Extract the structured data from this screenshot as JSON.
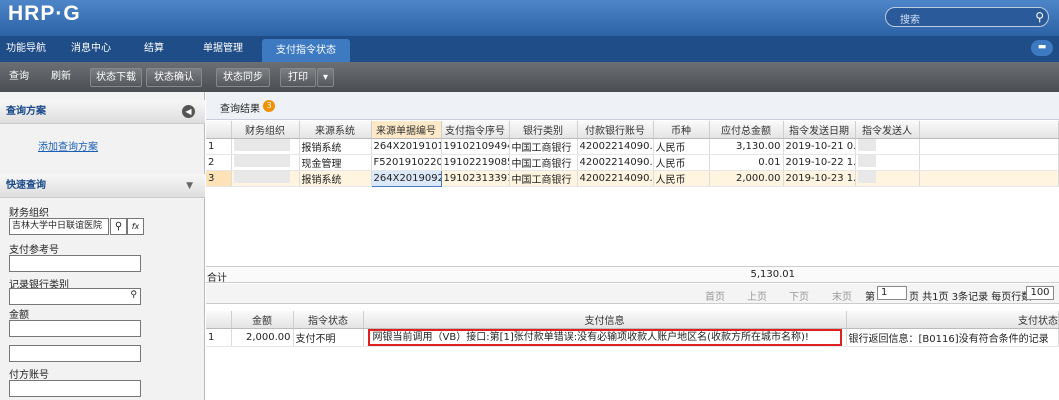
{
  "app": {
    "logo": "HRP·G",
    "search_placeholder": "搜索"
  },
  "nav": {
    "tabs": [
      "功能导航",
      "消息中心",
      "结算",
      "单据管理",
      "支付指令状态"
    ],
    "active": "支付指令状态"
  },
  "toolbar": {
    "buttons": [
      "查询",
      "刷新",
      "状态下载",
      "状态确认",
      "状态同步",
      "打印"
    ]
  },
  "sidebar": {
    "query_plan_title": "查询方案",
    "add_plan_link": "添加查询方案",
    "quick_query_title": "快速查询",
    "fields": [
      {
        "label": "财务组织",
        "value": "吉林大学中日联谊医院"
      },
      {
        "label": "支付参考号",
        "value": ""
      },
      {
        "label": "记录银行类别",
        "value": ""
      },
      {
        "label": "金额",
        "value": ""
      },
      {
        "label": "",
        "value": ""
      },
      {
        "label": "付方账号",
        "value": ""
      }
    ]
  },
  "results": {
    "title": "查询结果",
    "count": "3",
    "columns": [
      "财务组织",
      "来源系统",
      "来源单据编号",
      "支付指令序号",
      "银行类别",
      "付款银行账号",
      "币种",
      "应付总金额",
      "指令发送日期",
      "指令发送人"
    ],
    "rows": [
      {
        "n": "1",
        "org": "",
        "source": "报销系统",
        "doc": "264X2019101...",
        "seq": "19102109494...",
        "bank": "中国工商银行",
        "account": "42002214090...",
        "currency": "人民币",
        "amount": "3,130.00",
        "date": "2019-10-21 0...",
        "sender": ""
      },
      {
        "n": "2",
        "org": "",
        "source": "现金管理",
        "doc": "F5201910220...",
        "seq": "19102219085...",
        "bank": "中国工商银行",
        "account": "42002214090...",
        "currency": "人民币",
        "amount": "0.01",
        "date": "2019-10-22 1...",
        "sender": ""
      },
      {
        "n": "3",
        "org": "",
        "source": "报销系统",
        "doc": "264X2019092...",
        "seq": "19102313391...",
        "bank": "中国工商银行",
        "account": "42002214090...",
        "currency": "人民币",
        "amount": "2,000.00",
        "date": "2019-10-23 1...",
        "sender": ""
      }
    ],
    "total_label": "合计",
    "total_amount": "5,130.01"
  },
  "pager": {
    "first": "首页",
    "prev": "上页",
    "next": "下页",
    "last": "末页",
    "page_prefix": "第",
    "page_value": "1",
    "page_suffix": "页 共1页 3条记录 每页行数",
    "page_size": "100"
  },
  "detail": {
    "columns": [
      "金额",
      "指令状态",
      "支付信息",
      "支付状态"
    ],
    "row": {
      "n": "1",
      "amount": "2,000.00",
      "status": "支付不明",
      "pay_info": "网银当前调用（VB）接口:第[1]张付款单错误:没有必输项收款人账户地区名(收款方所在城市名称)!",
      "pay_status": "银行返回信息：[B0116]没有符合条件的记录"
    }
  },
  "colors": {
    "header": "#2c62a6",
    "nav": "#1f4d87",
    "toolbar": "#55585c",
    "highlight": "#e02020",
    "badge": "#f29100"
  }
}
